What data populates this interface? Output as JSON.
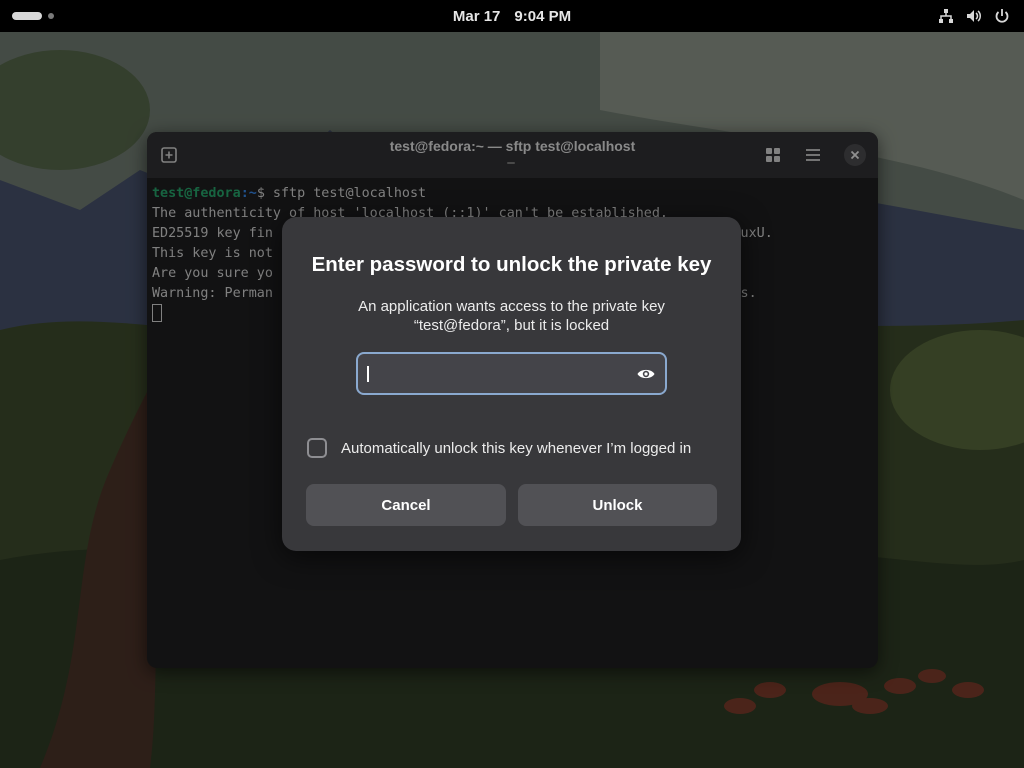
{
  "topbar": {
    "date": "Mar 17",
    "time": "9:04 PM",
    "tray_icons": [
      "network-icon",
      "volume-icon",
      "power-icon"
    ]
  },
  "terminal": {
    "title": "test@fedora:~ — sftp test@localhost",
    "prompt_user": "test@fedora",
    "prompt_path": ":~",
    "prompt_command": "$ sftp test@localhost",
    "lines": [
      "The authenticity of host 'localhost (::1)' can't be established.",
      "ED25519 key fin                                                 iGglTkEEKuxU.",
      "This key is not",
      "Are you sure yo                                                 ])? yes",
      "Warning: Perman                                                 nown hosts."
    ]
  },
  "dialog": {
    "title": "Enter password to unlock the private key",
    "message_line1": "An application wants access to the private key",
    "message_line2": "“test@fedora”, but it is locked",
    "password_value": "",
    "checkbox_label": "Automatically unlock this key whenever I’m logged in",
    "checkbox_checked": false,
    "cancel_label": "Cancel",
    "unlock_label": "Unlock"
  },
  "colors": {
    "accent_focus": "#8aa9cf",
    "prompt_user": "#26a269",
    "prompt_path": "#3584e4",
    "dialog_bg": "#38383b",
    "button_bg": "#515155"
  }
}
